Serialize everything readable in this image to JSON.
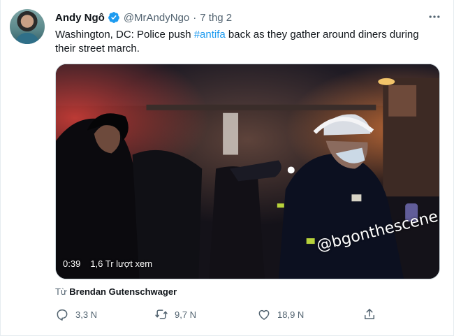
{
  "tweet": {
    "author_name": "Andy Ngô",
    "handle": "@MrAndyNgo",
    "separator": "·",
    "date": "7 thg 2",
    "text_before": "Washington, DC: Police push ",
    "hashtag": "#antifa",
    "text_after": " back as they gather around diners during their street march.",
    "video": {
      "duration": "0:39",
      "views": "1,6 Tr lượt xem",
      "watermark": "@bgonthescene"
    },
    "from_prefix": "Từ ",
    "from_author": "Brendan Gutenschwager",
    "counts": {
      "replies": "3,3 N",
      "retweets": "9,7 N",
      "likes": "18,9 N"
    }
  },
  "colors": {
    "accent": "#1d9bf0",
    "text": "#0f1419",
    "muted": "#536471"
  },
  "icons": [
    "verified-badge-icon",
    "more-icon",
    "reply-icon",
    "retweet-icon",
    "like-icon",
    "share-icon"
  ]
}
